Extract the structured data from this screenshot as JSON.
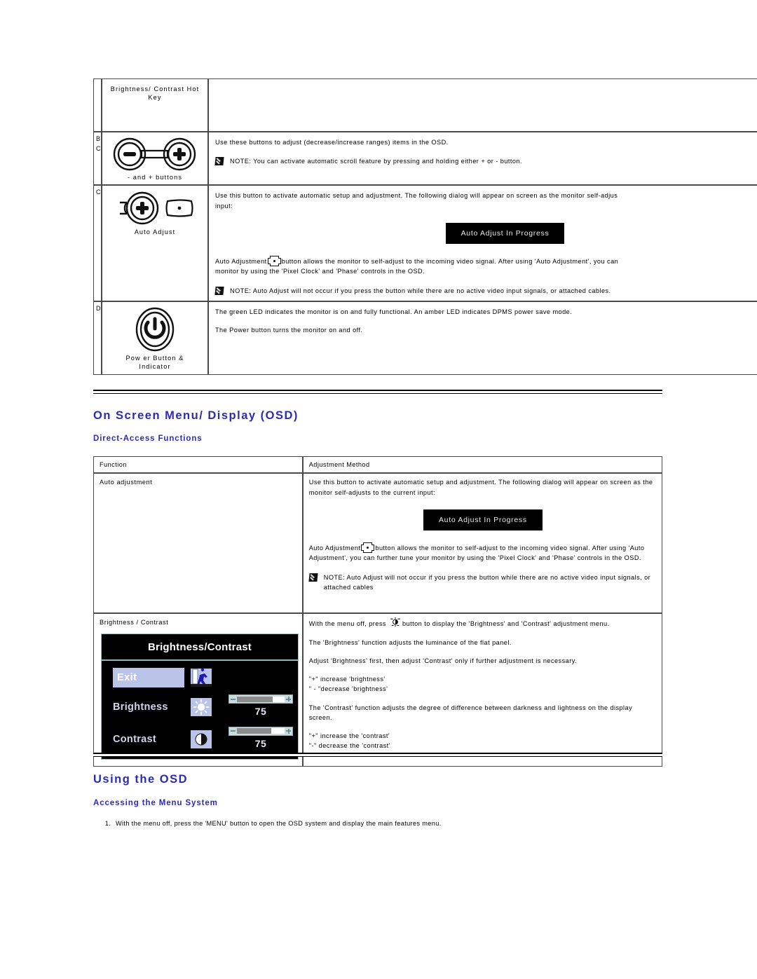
{
  "controls_table": {
    "rows": [
      {
        "id": "",
        "icon_name": "brightness-contrast-hotkey-icon",
        "caption": "Brightness/ Contrast Hot Key",
        "paragraphs": [],
        "notes": []
      },
      {
        "id": "B\nC",
        "icon_name": "minus-plus-buttons-icon",
        "caption": "- and + buttons",
        "paragraphs": [
          "Use these buttons to adjust (decrease/increase ranges) items in the OSD."
        ],
        "notes": [
          "NOTE: You can activate automatic scroll feature by pressing and holding either + or - button."
        ]
      },
      {
        "id": "C",
        "icon_name": "auto-adjust-button-icon",
        "caption": "Auto Adjust",
        "paragraphs": [
          "Use this button to activate automatic setup and adjustment. The following dialog will appear on screen as the monitor self-adjusts to the current input:",
          "Auto Adjustment [icon] button allows the monitor to self-adjust to the incoming video signal. After using 'Auto Adjustment', you can further tune your monitor by using the 'Pixel Clock' and 'Phase' controls in the OSD."
        ],
        "dialog": "Auto Adjust In Progress",
        "notes": [
          "NOTE: Auto Adjust will not occur if you press the button while there are no active video input signals, or attached cables."
        ]
      },
      {
        "id": "D",
        "icon_name": "power-button-icon",
        "caption": "Power Button & Indicator",
        "paragraphs": [
          "The green LED indicates the monitor is on and fully functional. An amber LED indicates DPMS power save mode.",
          "The Power button turns the monitor on and off."
        ],
        "notes": []
      }
    ],
    "auto_adjust_p1": "Use this button to activate automatic setup and adjustment. The following dialog will appear on screen as the monitor self-adjus",
    "auto_adjust_p1b": "input:",
    "auto_adjust_p2a": "Auto Adjustment",
    "auto_adjust_p2b": "button allows the monitor to self-adjust to the incoming video signal. After using 'Auto Adjustment', you can",
    "auto_adjust_p2c": "monitor by using the 'Pixel Clock' and 'Phase' controls in the OSD.",
    "auto_adjust_note": "NOTE: Auto Adjust will not occur if you press the button while there are no active video input signals, or attached cables.",
    "dialog_label": "Auto Adjust In Progress"
  },
  "headings": {
    "osd_section": "On Screen Menu/ Display (OSD)",
    "direct_access": "Direct-Access Functions",
    "using_osd": "Using the OSD",
    "accessing_menu": "Accessing the Menu System"
  },
  "direct_table": {
    "header": {
      "function": "Function",
      "method": "Adjustment Method"
    },
    "rows": [
      {
        "function": "Auto adjustment",
        "p1": "Use this button to activate automatic setup and adjustment. The following dialog will appear on screen as the monitor self-adjusts to the current input:",
        "dialog": "Auto Adjust In Progress",
        "p2a": "Auto Adjustment",
        "p2b": "button allows the monitor to self-adjust to the incoming video signal. After using 'Auto Adjustment', you can further tune your monitor by using the 'Pixel Clock' and 'Phase' controls in the OSD.",
        "note": "NOTE: Auto Adjust will not occur if you press the button while there are no active video input signals, or attached cables"
      },
      {
        "function": "Brightness / Contrast",
        "p1a": "With the menu off, press",
        "p1b": "button to display the 'Brightness' and 'Contrast' adjustment menu.",
        "p2": "The 'Brightness' function adjusts the luminance of the flat panel.",
        "p3": "Adjust 'Brightness' first, then adjust 'Contrast' only if further adjustment is necessary.",
        "p4a": "\"+\" increase 'brightness'",
        "p4b": "\" - \"decrease 'brightness'",
        "p5": "The 'Contrast' function adjusts the degree of difference between darkness and lightness on the display screen.",
        "p6a": "\"+\" increase the 'contrast'",
        "p6b": "\"-\" decrease the 'contrast'"
      }
    ]
  },
  "osd_panel": {
    "title": "Brightness/Contrast",
    "exit_label": "Exit",
    "brightness_label": "Brightness",
    "brightness_value": "75",
    "brightness_percent": 75,
    "contrast_label": "Contrast",
    "contrast_value": "75",
    "contrast_percent": 72
  },
  "steps": {
    "step1": "With the menu off, press the 'MENU' button to open the OSD system and display the main features menu."
  },
  "colors": {
    "heading_blue": "#2b2bb5",
    "table_border": "#4a4a4a",
    "dialog_bg": "#000000",
    "dialog_text": "#e9e9e9",
    "osd_bg": "#000000",
    "osd_accent": "#b9c4e8",
    "osd_border": "#8fb7bd"
  }
}
